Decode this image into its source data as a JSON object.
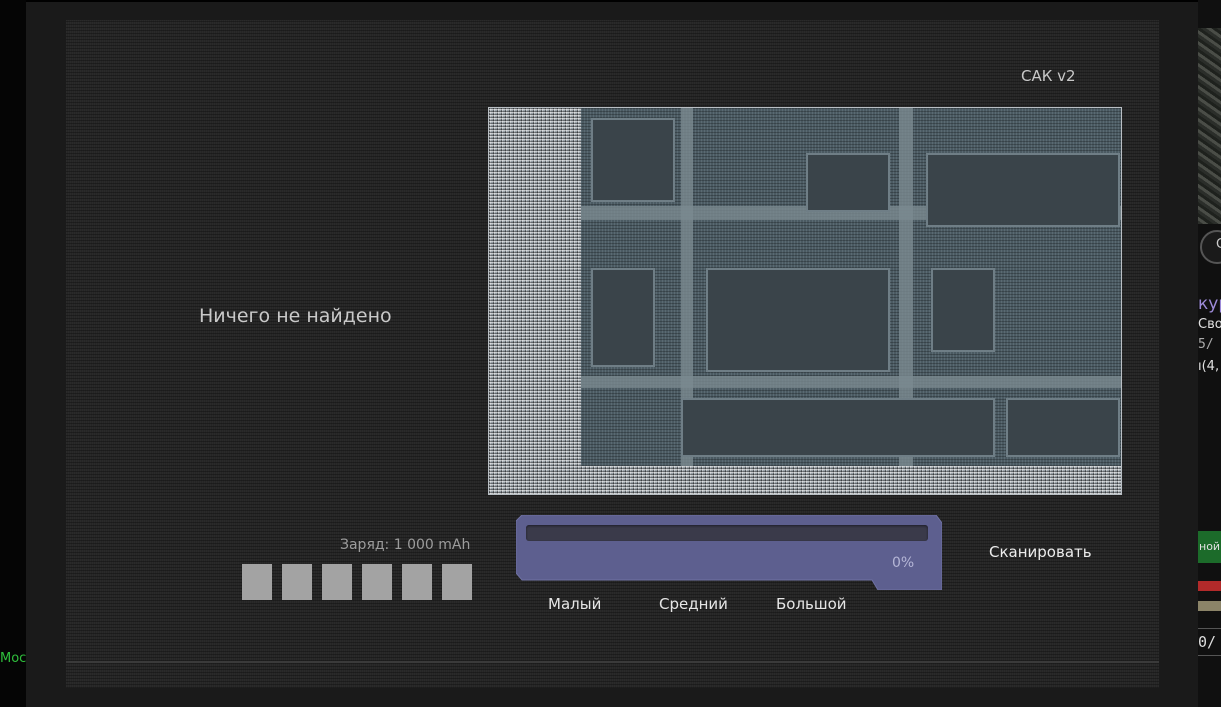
{
  "left_edge_text": "Мос",
  "right_edge": {
    "letter": "С",
    "line1": "кур",
    "line2": "Сво",
    "line3": "5/",
    "line4": "ı(4,",
    "green_label": "ной",
    "line5": "0/",
    "colors": {
      "green": "#1c6b2a",
      "red": "#b22a2a",
      "tan": "#8b8468"
    }
  },
  "dialog": {
    "version": "САК v2",
    "status": "Ничего не найдено",
    "charge_label": "Заряд: 1 000 mAh",
    "charge_cells": 6,
    "charge_cells_filled": 6,
    "progress": {
      "percent_text": "0%",
      "value": 0
    },
    "size_options": [
      "Малый",
      "Средний",
      "Большой"
    ],
    "scan_label": "Сканировать",
    "colors": {
      "progress_frame": "#5d5f8f",
      "progress_fill": "#8a8fd0",
      "cell": "#a3a3a3"
    }
  }
}
